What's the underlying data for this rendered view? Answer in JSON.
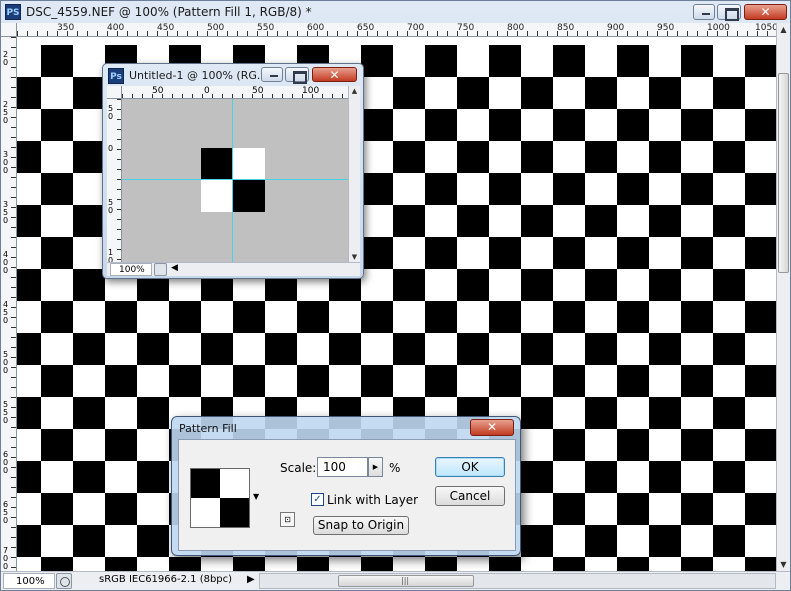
{
  "main_window": {
    "app_icon": "PS",
    "title": "DSC_4559.NEF @ 100% (Pattern Fill 1, RGB/8) *",
    "controls": {
      "minimize": "minimize-icon",
      "maximize": "maximize-icon",
      "close": "✕"
    },
    "ruler_labels": [
      "350",
      "400",
      "450",
      "500",
      "550",
      "600",
      "650",
      "700",
      "750",
      "800",
      "850",
      "900",
      "950",
      "1000",
      "1050"
    ],
    "vruler_labels": [
      "2 0",
      "2 5 0",
      "3 0 0",
      "3 5 0",
      "4 0 0",
      "4 5 0",
      "5 0 0",
      "5 5 0",
      "6 0 0",
      "6 5 0",
      "7 0 0"
    ]
  },
  "status_bar": {
    "zoom": "100%",
    "doc_info": "sRGB IEC61966-2.1 (8bpc)",
    "arrow": "▶",
    "grip": "|||"
  },
  "sub_window": {
    "app_icon": "Ps",
    "title": "Untitled-1 @ 100% (RG...",
    "controls": {
      "minimize": "minimize-icon",
      "maximize": "maximize-icon",
      "close": "✕"
    },
    "ruler_labels": [
      "50",
      "0",
      "50",
      "100"
    ],
    "vruler_labels": [
      "5 0",
      "0",
      "5 0",
      "1 0"
    ],
    "zoom": "100%",
    "arrow": "◀"
  },
  "dialog": {
    "title": "Pattern Fill",
    "close": "✕",
    "scale_label": "Scale:",
    "scale_value": "100",
    "scale_unit": "%",
    "spin_arrow": "▶",
    "link_with_layer_label": "Link with Layer",
    "link_with_layer_checked": true,
    "check_mark": "✓",
    "snap_to_origin_label": "Snap to Origin",
    "ok_label": "OK",
    "cancel_label": "Cancel",
    "swatch_arrow": "▼",
    "new_preset_icon": "⊡"
  },
  "colors": {
    "guide": "#47d3e6",
    "close_red": "#c23b22",
    "canvas_gray": "#c0c0c0"
  }
}
